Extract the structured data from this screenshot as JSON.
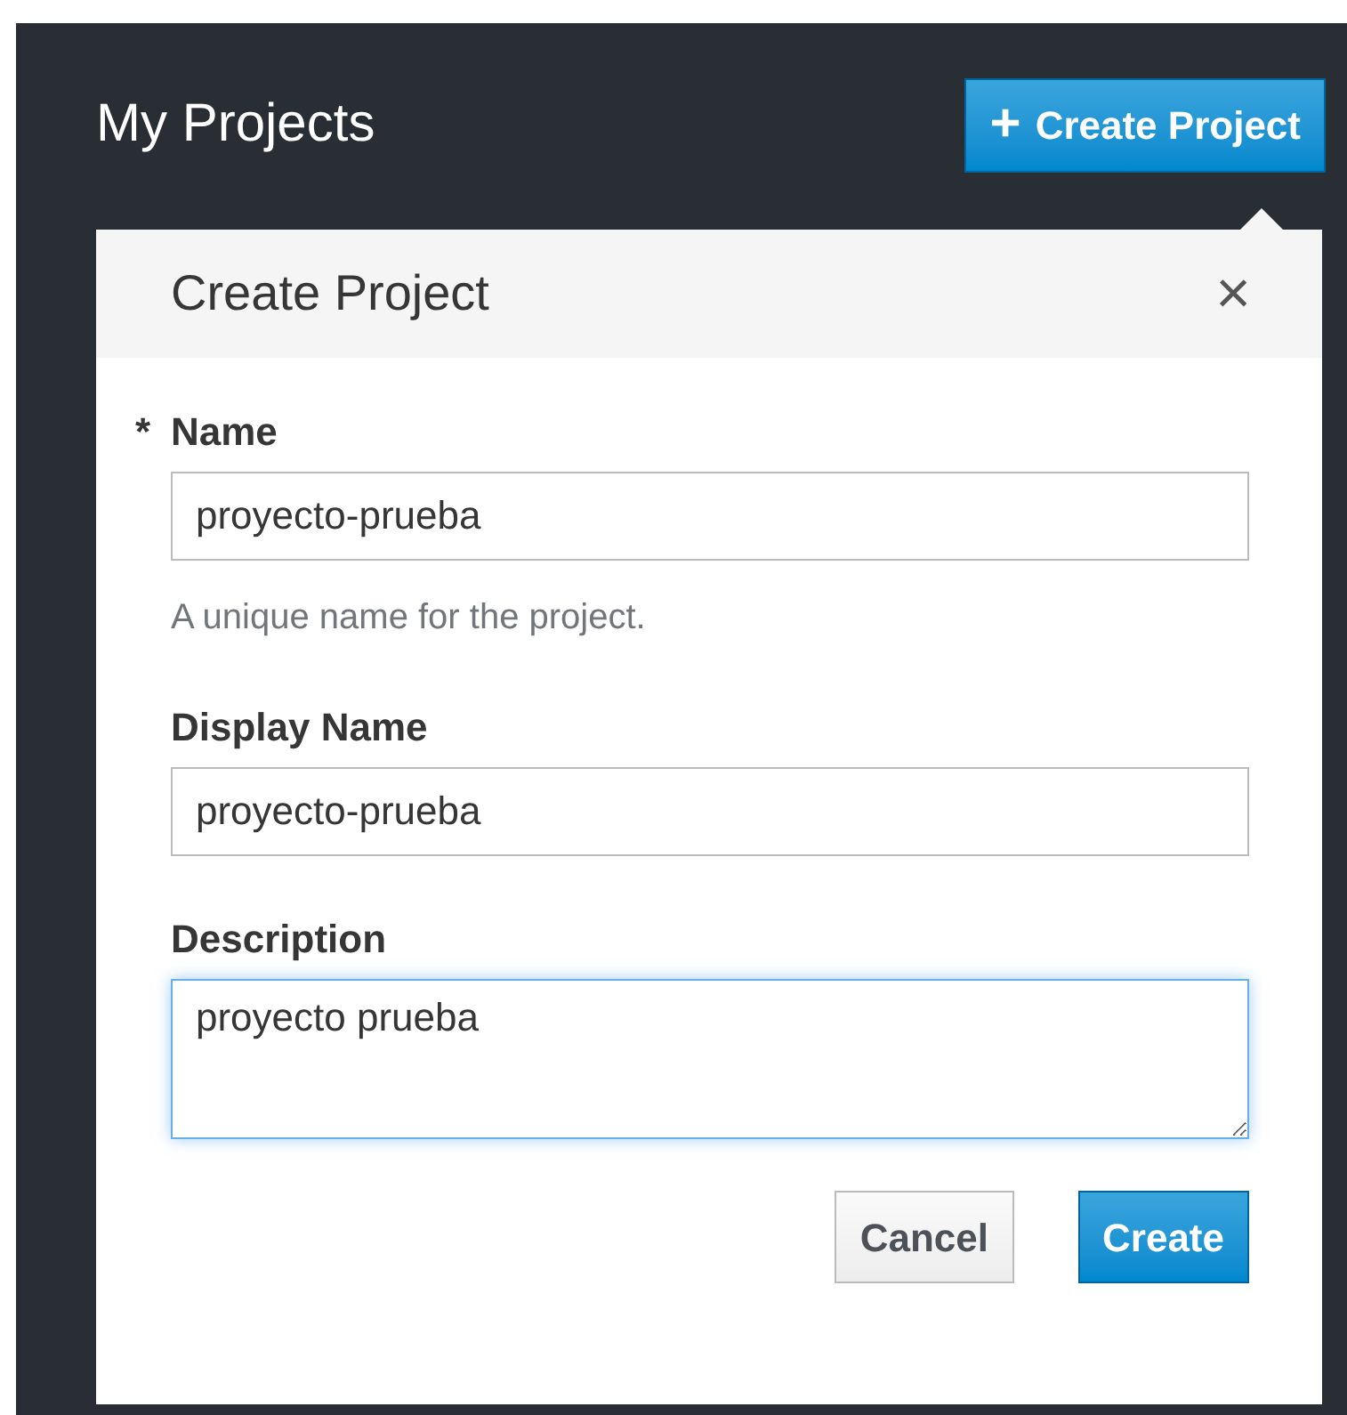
{
  "page": {
    "title": "My Projects"
  },
  "create_button": {
    "icon": "+",
    "label": "Create Project"
  },
  "dialog": {
    "title": "Create Project",
    "close": "×",
    "fields": [
      {
        "kind": "input",
        "label": "Name",
        "required_mark": "*",
        "value": "proyecto-prueba",
        "help": "A unique name for the project.",
        "focused": false
      },
      {
        "kind": "input",
        "label": "Display Name",
        "value": "proyecto-prueba",
        "focused": false
      },
      {
        "kind": "textarea",
        "label": "Description",
        "value": "proyecto prueba",
        "focused": true
      }
    ],
    "buttons": [
      {
        "label": "Cancel",
        "primary": false
      },
      {
        "label": "Create",
        "primary": true
      }
    ]
  }
}
